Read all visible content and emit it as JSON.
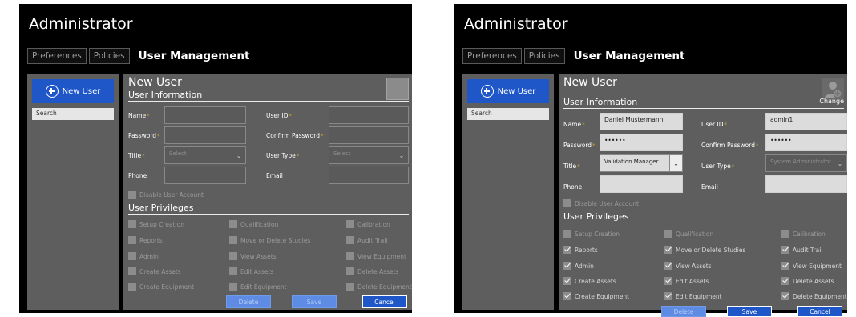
{
  "screens": [
    {
      "app_title": "Administrator",
      "tabs": [
        "Preferences",
        "Policies"
      ],
      "active_tab": "User Management",
      "sidebar": {
        "new_user_label": "New User",
        "search_placeholder": "Search"
      },
      "panel": {
        "title": "New User",
        "user_info_title": "User Information",
        "change_label": "",
        "fields": {
          "name_label": "Name",
          "name_value": "",
          "user_id_label": "User ID",
          "user_id_value": "",
          "password_label": "Password",
          "password_value": "",
          "confirm_password_label": "Confirm Password",
          "confirm_password_value": "",
          "title_label": "Title",
          "title_value": "Select",
          "user_type_label": "User Type",
          "user_type_value": "Select",
          "phone_label": "Phone",
          "phone_value": "",
          "email_label": "Email",
          "email_value": ""
        },
        "disable_account_label": "Disable User Account",
        "privileges_title": "User Privileges",
        "privileges": [
          {
            "label": "Setup Creation",
            "checked": false
          },
          {
            "label": "Qualification",
            "checked": false
          },
          {
            "label": "Calibration",
            "checked": false
          },
          {
            "label": "Reports",
            "checked": false
          },
          {
            "label": "Move or Delete Studies",
            "checked": false
          },
          {
            "label": "Audit Trail",
            "checked": false
          },
          {
            "label": "Admin",
            "checked": false
          },
          {
            "label": "View Assets",
            "checked": false
          },
          {
            "label": "View Equipment",
            "checked": false
          },
          {
            "label": "Create Assets",
            "checked": false
          },
          {
            "label": "Edit Assets",
            "checked": false
          },
          {
            "label": "Delete Assets",
            "checked": false
          },
          {
            "label": "Create Equipment",
            "checked": false
          },
          {
            "label": "Edit Equipment",
            "checked": false
          },
          {
            "label": "Delete Equipment",
            "checked": false
          }
        ],
        "buttons": {
          "delete": "Delete",
          "save": "Save",
          "cancel": "Cancel"
        }
      }
    },
    {
      "app_title": "Administrator",
      "tabs": [
        "Preferences",
        "Policies"
      ],
      "active_tab": "User Management",
      "sidebar": {
        "new_user_label": "New User",
        "search_placeholder": "Search"
      },
      "panel": {
        "title": "New User",
        "user_info_title": "User Information",
        "change_label": "Change",
        "fields": {
          "name_label": "Name",
          "name_value": "Daniel Mustermann",
          "user_id_label": "User ID",
          "user_id_value": "admin1",
          "password_label": "Password",
          "password_value": "••••••",
          "confirm_password_label": "Confirm Password",
          "confirm_password_value": "••••••",
          "title_label": "Title",
          "title_value": "Validation Manager",
          "user_type_label": "User Type",
          "user_type_value": "System Administrator",
          "phone_label": "Phone",
          "phone_value": "",
          "email_label": "Email",
          "email_value": ""
        },
        "disable_account_label": "Disable User Account",
        "privileges_title": "User Privileges",
        "privileges": [
          {
            "label": "Setup Creation",
            "checked": false
          },
          {
            "label": "Qualification",
            "checked": false
          },
          {
            "label": "Calibration",
            "checked": false
          },
          {
            "label": "Reports",
            "checked": true
          },
          {
            "label": "Move or Delete Studies",
            "checked": true
          },
          {
            "label": "Audit Trail",
            "checked": true
          },
          {
            "label": "Admin",
            "checked": true
          },
          {
            "label": "View Assets",
            "checked": true
          },
          {
            "label": "View Equipment",
            "checked": true
          },
          {
            "label": "Create Assets",
            "checked": true
          },
          {
            "label": "Edit Assets",
            "checked": true
          },
          {
            "label": "Delete Assets",
            "checked": true
          },
          {
            "label": "Create Equipment",
            "checked": true
          },
          {
            "label": "Edit Equipment",
            "checked": true
          },
          {
            "label": "Delete Equipment",
            "checked": true
          }
        ],
        "buttons": {
          "delete": "Delete",
          "save": "Save",
          "cancel": "Cancel"
        }
      }
    }
  ],
  "colors": {
    "accent": "#1f57c9",
    "panel": "#5e5e5e",
    "background": "#000000",
    "required": "#c9a52e"
  }
}
